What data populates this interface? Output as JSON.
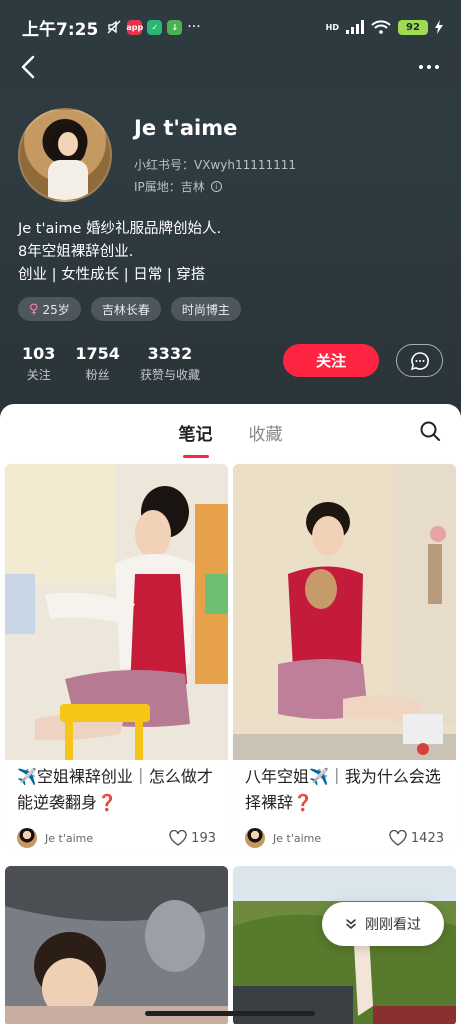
{
  "status_bar": {
    "time": "上午7:25",
    "battery": "92",
    "hd": "HD"
  },
  "profile": {
    "name": "Je t'aime",
    "xhs_id": "小红书号：VXwyh11111111",
    "ip_location": "IP属地：吉林",
    "bio_lines": [
      "Je t'aime 婚纱礼服品牌创始人.",
      "8年空姐裸辞创业.",
      "创业 | 女性成长 | 日常 | 穿搭"
    ],
    "tags": [
      {
        "label": "25岁",
        "icon": "female-icon"
      },
      {
        "label": "吉林长春"
      },
      {
        "label": "时尚博主"
      }
    ],
    "stats": [
      {
        "value": "103",
        "label": "关注"
      },
      {
        "value": "1754",
        "label": "粉丝"
      },
      {
        "value": "3332",
        "label": "获赞与收藏"
      }
    ],
    "follow_label": "关注"
  },
  "tabs": [
    {
      "label": "笔记",
      "active": true
    },
    {
      "label": "收藏",
      "active": false
    }
  ],
  "notes": [
    {
      "title": "✈️空姐裸辞创业｜怎么做才能逆袭翻身❓",
      "author": "Je t'aime",
      "likes": "193"
    },
    {
      "title": "八年空姐✈️｜我为什么会选择裸辞❓",
      "author": "Je t'aime",
      "likes": "1423"
    }
  ],
  "history_label": "刚刚看过",
  "colors": {
    "accent": "#ff2442",
    "header_bg": "#2d3a40"
  }
}
